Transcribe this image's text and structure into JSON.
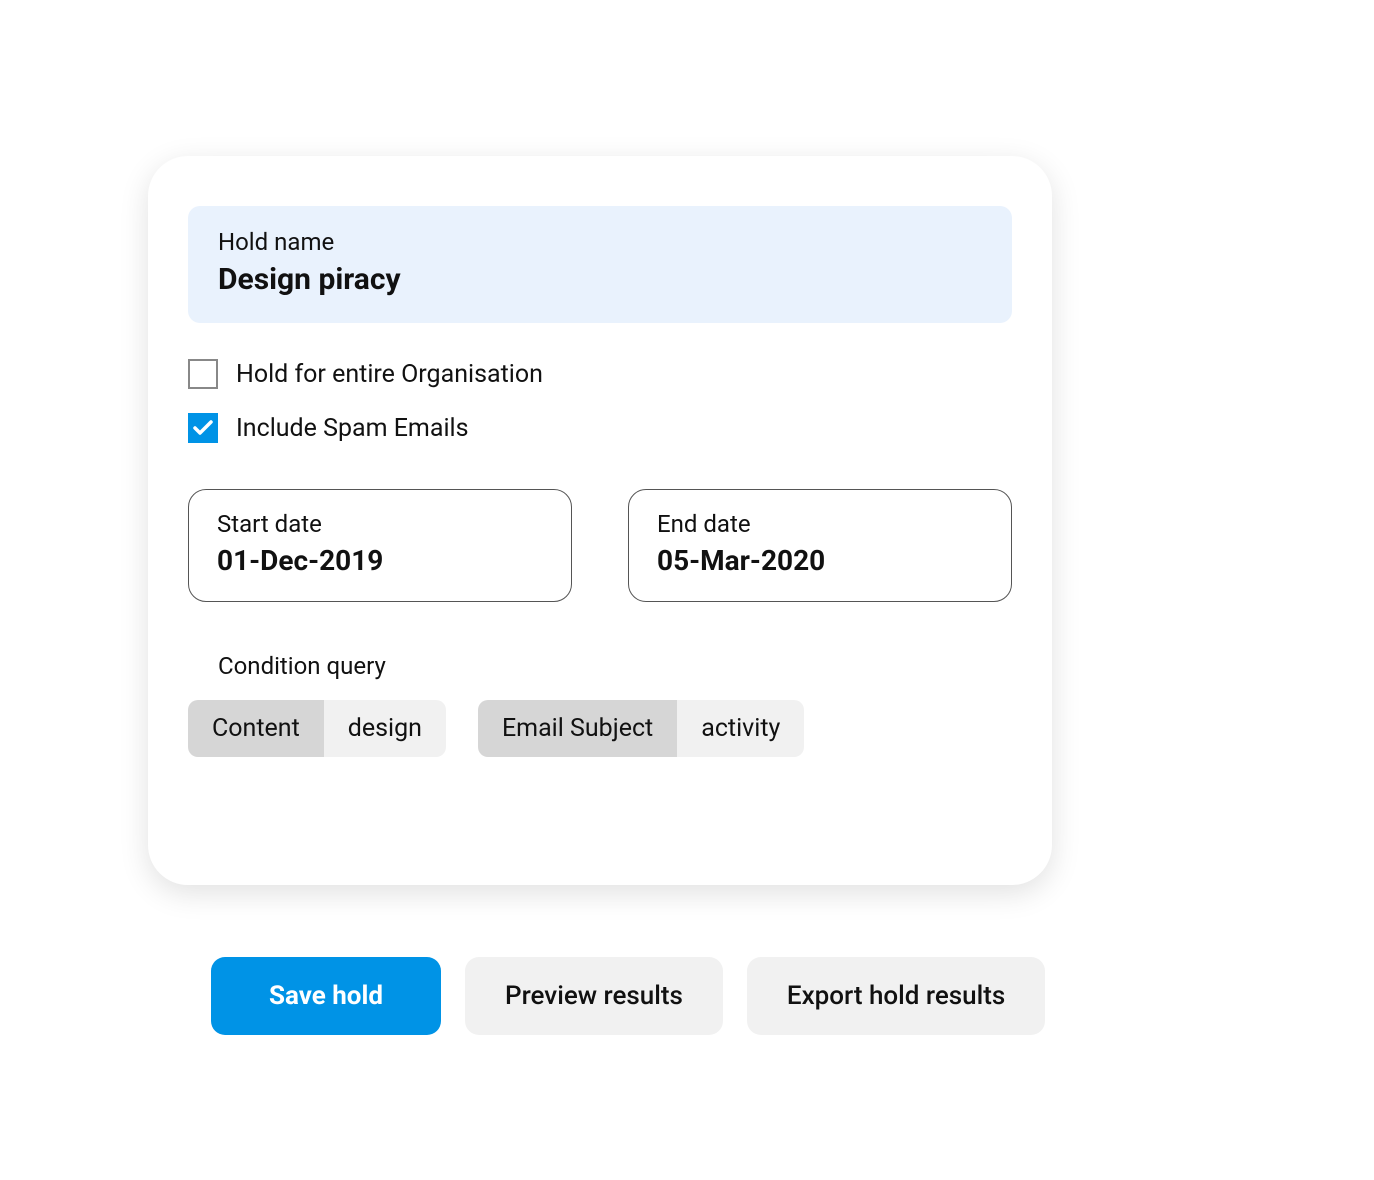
{
  "holdName": {
    "label": "Hold name",
    "value": "Design piracy"
  },
  "checkboxes": {
    "entireOrg": {
      "label": "Hold for entire Organisation",
      "checked": false
    },
    "includeSpam": {
      "label": "Include Spam Emails",
      "checked": true
    }
  },
  "dates": {
    "start": {
      "label": "Start date",
      "value": "01-Dec-2019"
    },
    "end": {
      "label": "End date",
      "value": "05-Mar-2020"
    }
  },
  "conditionQuery": {
    "title": "Condition query",
    "chips": [
      {
        "key": "Content",
        "value": "design"
      },
      {
        "key": "Email Subject",
        "value": "activity"
      }
    ]
  },
  "buttons": {
    "save": "Save hold",
    "preview": "Preview results",
    "export": "Export hold results"
  }
}
